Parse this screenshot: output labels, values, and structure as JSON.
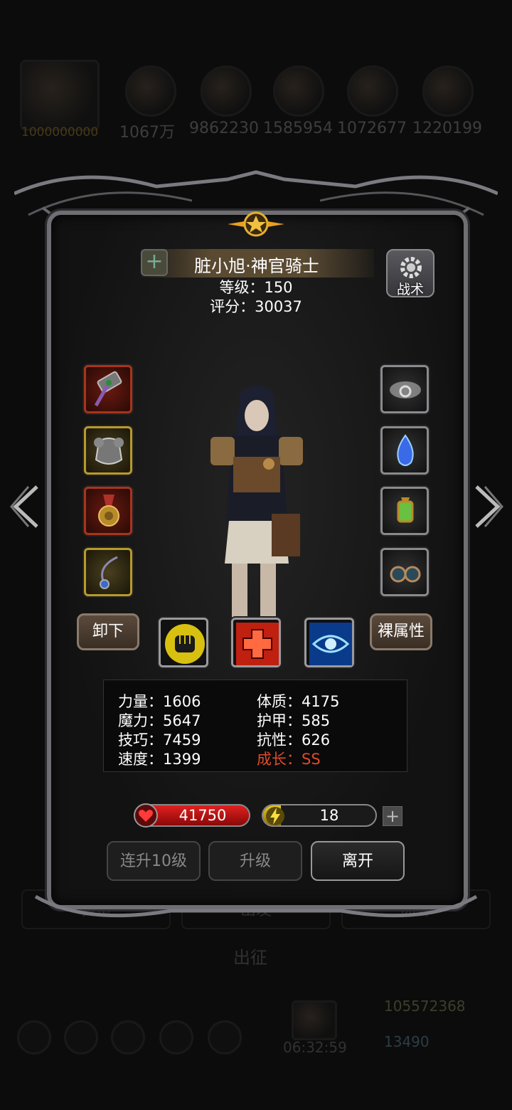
{
  "background": {
    "gold": "1000000000",
    "resources": [
      "1067万",
      "9862230",
      "1585954",
      "1072677",
      "1220199"
    ],
    "tabs": [
      "首页",
      "出发",
      "离开"
    ],
    "deploy_label": "出征",
    "timer": "06:32:59",
    "coins": "105572368",
    "gems": "13490"
  },
  "hero": {
    "name": "脏小旭·神官骑士",
    "level": "等级：150",
    "score": "评分：30037"
  },
  "tactics_label": "战术",
  "equipment": {
    "left": [
      "hammer-icon",
      "armor-icon",
      "medal-icon",
      "necklace-icon"
    ],
    "right": [
      "cloud-ring-icon",
      "blue-flame-icon",
      "lantern-icon",
      "goggles-icon"
    ]
  },
  "actions": {
    "unequip": "卸下",
    "naked_stats": "裸属性"
  },
  "skills": [
    "fist-icon",
    "cross-icon",
    "eye-icon"
  ],
  "stats": {
    "strength": "力量：1606",
    "magic": "魔力：5647",
    "skill": "技巧：7459",
    "speed": "速度：1399",
    "constitution": "体质：4175",
    "armor": "护甲：585",
    "resistance": "抗性：626",
    "growth": "成长：SS"
  },
  "hp": {
    "value": "41750",
    "fill": 1.0
  },
  "energy": {
    "value": "18",
    "fill": 0.16,
    "plus": "+"
  },
  "buttons": {
    "upgrade10": "连升10级",
    "upgrade": "升级",
    "leave": "离开"
  },
  "colors": {
    "growth": "#e04a2a",
    "hp": "#e02020",
    "energy": "#e8c820"
  }
}
